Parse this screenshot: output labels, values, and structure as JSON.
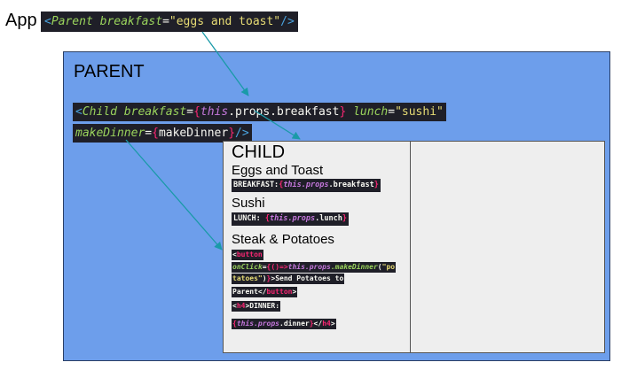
{
  "app": {
    "label": "App",
    "parent_tag_open": "<",
    "parent_name": "Parent",
    "parent_attr": "breakfast",
    "equals": "=",
    "parent_value": "\"eggs and toast\"",
    "parent_tag_close": "/>"
  },
  "parent": {
    "title": "PARENT",
    "child_line1": {
      "open": "<",
      "name": "Child",
      "attr1": "breakfast",
      "eq": "=",
      "brace_open": "{",
      "this": "this",
      "prop_path": ".props.breakfast",
      "brace_close": "}",
      "attr2": "lunch",
      "value2": "\"sushi\""
    },
    "child_line2": {
      "attr": "makeDinner",
      "eq": "=",
      "brace_open": "{",
      "value": "makeDinner",
      "brace_close": "}",
      "close": "/>"
    }
  },
  "child": {
    "title": "CHILD",
    "eggs_heading": "Eggs and Toast",
    "breakfast_label": "BREAKFAST:",
    "breakfast_brace_open": "{",
    "breakfast_this": "this",
    "breakfast_path": ".props",
    "breakfast_field": ".breakfast",
    "breakfast_brace_close": "}",
    "sushi_heading": "Sushi",
    "lunch_label": "LUNCH: ",
    "lunch_brace_open": "{",
    "lunch_this": "this",
    "lunch_path": ".props",
    "lunch_field": ".lunch",
    "lunch_brace_close": "}",
    "steak_heading": "Steak & Potatoes",
    "button_code": {
      "line1_open": "<",
      "line1_tag": "button",
      "line2_attr": "onClick",
      "line2_eq": "=",
      "line2_brace": "{",
      "line2_arrow": "()=>",
      "line2_this": "this",
      "line2_path": ".props",
      "line2_fn": ".makeDinner",
      "line2_paren": "(",
      "line2_str": "\"po",
      "line3_str": "tatoes\"",
      "line3_rest_a": ")",
      "line3_brace": "}",
      "line3_gt": ">",
      "line3_text": "Send Potatoes to",
      "line4_text": "Parent",
      "line4_close_open": "</",
      "line4_tag": "button",
      "line4_gt": ">",
      "line5_open": "<",
      "line5_tag": "h4",
      "line5_gt": ">",
      "line5_text": "DINNER:",
      "line6_brace_open": "{",
      "line6_this": "this",
      "line6_path": ".props",
      "line6_field": ".dinner",
      "line6_brace_close": "}",
      "line6_close_open": "</",
      "line6_tag": "h4",
      "line6_gt": ">"
    }
  },
  "colors": {
    "parent_bg": "#6d9eeb",
    "child_bg": "#eeeeee",
    "arrow": "#1a9aa8",
    "code_bg": "#1f1f28"
  }
}
